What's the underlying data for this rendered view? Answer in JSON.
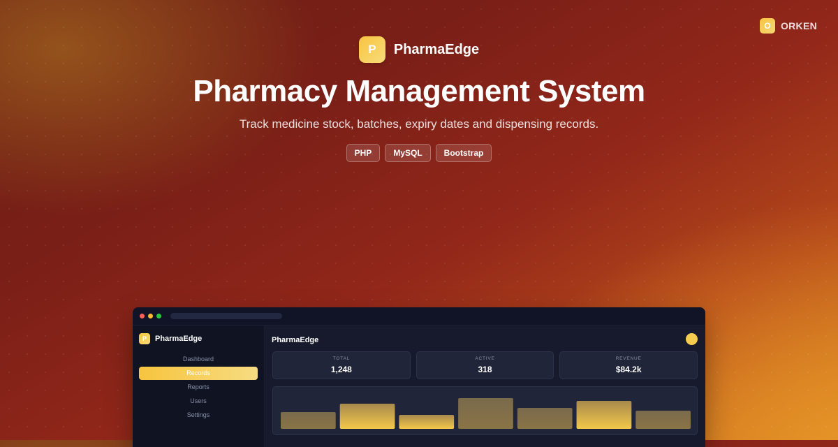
{
  "corner": {
    "logo_letter": "O",
    "name": "ORKEN"
  },
  "hero": {
    "logo_letter": "P",
    "brand": "PharmaEdge",
    "title": "Pharmacy Management System",
    "subtitle": "Track medicine stock, batches, expiry dates and dispensing records.",
    "tags": [
      "PHP",
      "MySQL",
      "Bootstrap"
    ]
  },
  "colors": {
    "accent": "#f8c440",
    "bg_dark": "#161a2c",
    "sidebar": "#0f1322"
  },
  "app": {
    "sidebar": {
      "logo_letter": "P",
      "brand": "PharmaEdge",
      "items": [
        {
          "label": "Dashboard",
          "active": false
        },
        {
          "label": "Records",
          "active": true
        },
        {
          "label": "Reports",
          "active": false
        },
        {
          "label": "Users",
          "active": false
        },
        {
          "label": "Settings",
          "active": false
        }
      ]
    },
    "header": {
      "title": "PharmaEdge"
    },
    "stats": [
      {
        "label": "TOTAL",
        "value": "1,248"
      },
      {
        "label": "ACTIVE",
        "value": "318"
      },
      {
        "label": "REVENUE",
        "value": "$84.2k"
      }
    ]
  },
  "chart_data": {
    "type": "bar",
    "values": [
      24,
      36,
      20,
      44,
      30,
      40,
      26
    ],
    "ylim": [
      0,
      50
    ],
    "grid": false,
    "highlight_indices": [
      1,
      2,
      5
    ]
  }
}
